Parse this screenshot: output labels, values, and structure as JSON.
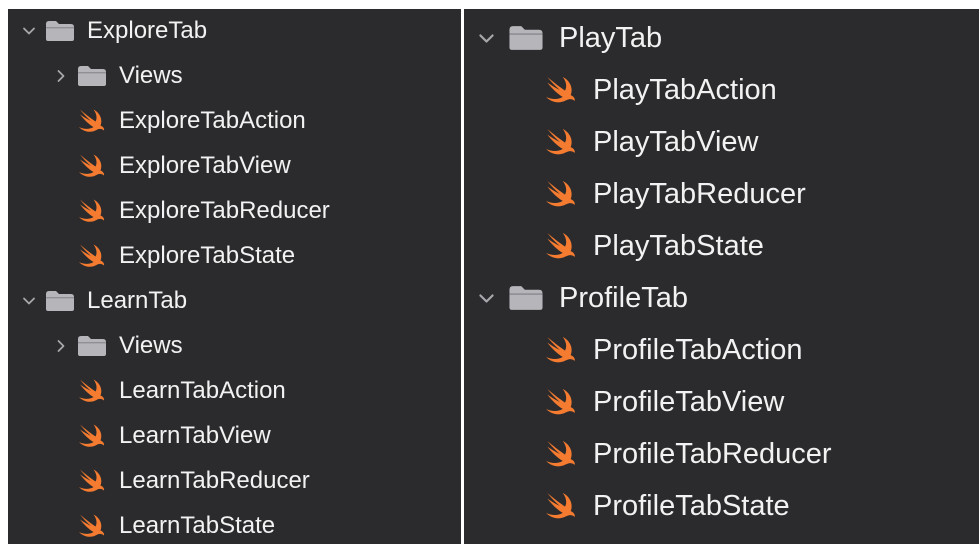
{
  "colors": {
    "background": "#2b2b2d",
    "text": "#f2f2f2",
    "folder": "#b5b5ba",
    "chevron": "#a7a7ac",
    "swift_accent": "#f47b2f"
  },
  "left_tree": {
    "explore": {
      "label": "ExploreTab",
      "icon": "folder-icon",
      "expanded": true,
      "views_label": "Views",
      "files": [
        "ExploreTabAction",
        "ExploreTabView",
        "ExploreTabReducer",
        "ExploreTabState"
      ]
    },
    "learn": {
      "label": "LearnTab",
      "icon": "folder-icon",
      "expanded": true,
      "views_label": "Views",
      "files": [
        "LearnTabAction",
        "LearnTabView",
        "LearnTabReducer",
        "LearnTabState"
      ]
    }
  },
  "right_tree": {
    "play": {
      "label": "PlayTab",
      "icon": "folder-icon",
      "expanded": true,
      "files": [
        "PlayTabAction",
        "PlayTabView",
        "PlayTabReducer",
        "PlayTabState"
      ]
    },
    "profile": {
      "label": "ProfileTab",
      "icon": "folder-icon",
      "expanded": true,
      "files": [
        "ProfileTabAction",
        "ProfileTabView",
        "ProfileTabReducer",
        "ProfileTabState"
      ]
    }
  }
}
